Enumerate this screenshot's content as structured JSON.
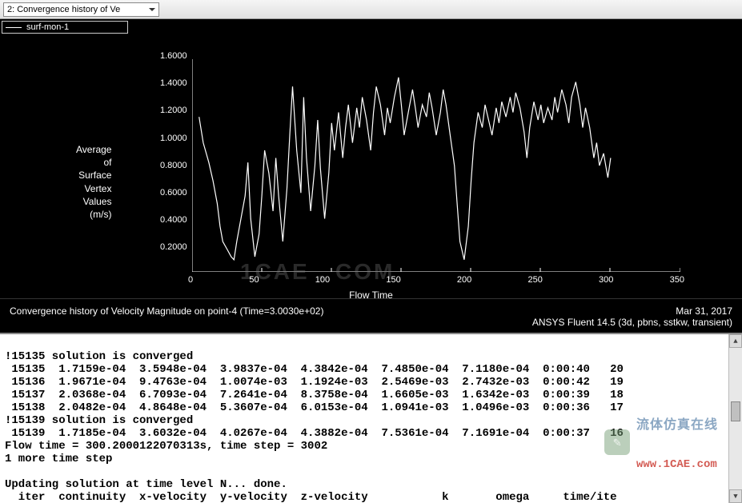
{
  "toolbar": {
    "dropdown_selected": "2: Convergence history of Ve"
  },
  "legend": {
    "series_name": "surf-mon-1"
  },
  "chart": {
    "y_label_lines": [
      "Average",
      "of",
      "Surface",
      "Vertex",
      "Values",
      "(m/s)"
    ],
    "y_ticks": [
      "1.6000",
      "1.4000",
      "1.2000",
      "1.0000",
      "0.8000",
      "0.6000",
      "0.4000",
      "0.2000"
    ],
    "x_ticks": [
      "0",
      "50",
      "100",
      "150",
      "200",
      "250",
      "300",
      "350"
    ],
    "x_label": "Flow Time",
    "title_left": "Convergence history of Velocity Magnitude on point-4  (Time=3.0030e+02)",
    "title_right": "Mar 31, 2017",
    "subtitle_right": "ANSYS Fluent 14.5 (3d, pbns, sstkw, transient)",
    "watermark": "1CAE . COM"
  },
  "chart_data": {
    "type": "line",
    "title": "Convergence history of Velocity Magnitude on point-4 (Time=3.0030e+02)",
    "xlabel": "Flow Time",
    "ylabel": "Average of Surface Vertex Values (m/s)",
    "ylim": [
      0.2,
      1.6
    ],
    "xlim": [
      0,
      350
    ],
    "series": [
      {
        "name": "surf-mon-1",
        "x": [
          5,
          8,
          12,
          15,
          18,
          20,
          22,
          25,
          28,
          30,
          32,
          35,
          38,
          40,
          42,
          45,
          48,
          50,
          52,
          55,
          58,
          60,
          62,
          65,
          68,
          70,
          72,
          75,
          78,
          80,
          82,
          85,
          88,
          90,
          92,
          95,
          98,
          100,
          102,
          105,
          108,
          110,
          112,
          115,
          118,
          120,
          122,
          125,
          128,
          130,
          132,
          135,
          138,
          140,
          142,
          145,
          148,
          150,
          152,
          155,
          158,
          160,
          162,
          165,
          168,
          170,
          172,
          175,
          178,
          180,
          182,
          185,
          188,
          190,
          192,
          195,
          198,
          200,
          202,
          205,
          208,
          210,
          212,
          215,
          218,
          220,
          222,
          225,
          228,
          230,
          232,
          235,
          238,
          240,
          242,
          245,
          248,
          250,
          252,
          255,
          258,
          260,
          262,
          265,
          268,
          270,
          272,
          275,
          278,
          280,
          282,
          285,
          288,
          290,
          292,
          295,
          298,
          300
        ],
        "y": [
          1.22,
          1.05,
          0.92,
          0.8,
          0.65,
          0.5,
          0.4,
          0.35,
          0.3,
          0.28,
          0.4,
          0.55,
          0.7,
          0.92,
          0.55,
          0.3,
          0.45,
          0.7,
          1.0,
          0.85,
          0.6,
          0.95,
          0.7,
          0.4,
          0.75,
          1.1,
          1.42,
          1.0,
          0.72,
          1.35,
          0.95,
          0.6,
          0.9,
          1.2,
          0.88,
          0.55,
          0.85,
          1.18,
          1.0,
          1.25,
          0.95,
          1.15,
          1.3,
          1.05,
          1.28,
          1.15,
          1.35,
          1.2,
          1.0,
          1.25,
          1.42,
          1.3,
          1.1,
          1.28,
          1.18,
          1.35,
          1.48,
          1.3,
          1.1,
          1.25,
          1.4,
          1.28,
          1.15,
          1.3,
          1.22,
          1.38,
          1.28,
          1.1,
          1.25,
          1.4,
          1.3,
          1.1,
          0.9,
          0.65,
          0.4,
          0.28,
          0.5,
          0.8,
          1.05,
          1.25,
          1.15,
          1.3,
          1.22,
          1.1,
          1.28,
          1.18,
          1.32,
          1.22,
          1.35,
          1.25,
          1.38,
          1.28,
          1.12,
          0.95,
          1.15,
          1.32,
          1.2,
          1.3,
          1.18,
          1.28,
          1.2,
          1.35,
          1.25,
          1.4,
          1.3,
          1.18,
          1.35,
          1.45,
          1.3,
          1.15,
          1.28,
          1.15,
          0.95,
          1.05,
          0.9,
          0.98,
          0.82,
          0.95
        ]
      }
    ]
  },
  "console_lines": [
    "!15135 solution is converged",
    " 15135  1.7159e-04  3.5948e-04  3.9837e-04  4.3842e-04  7.4850e-04  7.1180e-04  0:00:40   20",
    " 15136  1.9671e-04  9.4763e-04  1.0074e-03  1.1924e-03  2.5469e-03  2.7432e-03  0:00:42   19",
    " 15137  2.0368e-04  6.7093e-04  7.2641e-04  8.3758e-04  1.6605e-03  1.6342e-03  0:00:39   18",
    " 15138  2.0482e-04  4.8648e-04  5.3607e-04  6.0153e-04  1.0941e-03  1.0496e-03  0:00:36   17",
    "!15139 solution is converged",
    " 15139  1.7185e-04  3.6032e-04  4.0267e-04  4.3882e-04  7.5361e-04  7.1691e-04  0:00:37   16",
    "Flow time = 300.2000122070313s, time step = 3002",
    "1 more time step",
    "",
    "Updating solution at time level N... done.",
    "  iter  continuity  x-velocity  y-velocity  z-velocity           k       omega     time/ite"
  ],
  "watermark_footer": {
    "cn_text": "流体仿真在线",
    "url_text": "www.1CAE.com"
  }
}
